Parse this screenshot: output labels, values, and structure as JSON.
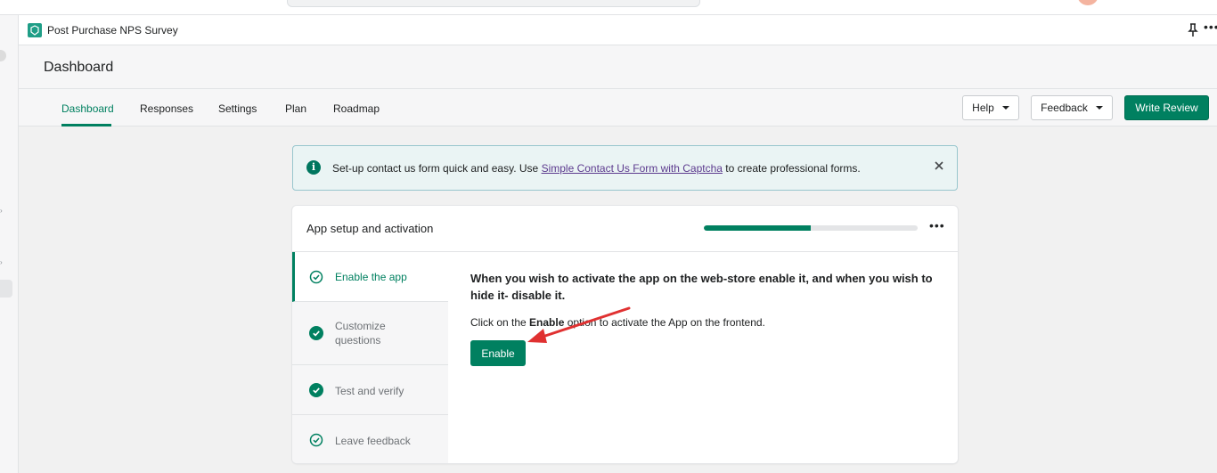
{
  "app": {
    "name": "Post Purchase NPS Survey",
    "page_title": "Dashboard"
  },
  "nav": {
    "tabs": [
      {
        "label": "Dashboard",
        "active": true
      },
      {
        "label": "Responses",
        "active": false
      },
      {
        "label": "Settings",
        "active": false
      },
      {
        "label": "Plan",
        "active": false
      },
      {
        "label": "Roadmap",
        "active": false
      }
    ],
    "help_label": "Help",
    "feedback_label": "Feedback",
    "write_review_label": "Write Review"
  },
  "banner": {
    "text_before": "Set-up contact us form quick and easy. Use ",
    "link_text": "Simple Contact Us Form with Captcha",
    "text_after": " to create professional forms."
  },
  "setup": {
    "title": "App setup and activation",
    "progress": 0.5,
    "steps": [
      {
        "label": "Enable the app",
        "active": true
      },
      {
        "label": "Customize questions",
        "active": false
      },
      {
        "label": "Test and verify",
        "active": false
      },
      {
        "label": "Leave feedback",
        "active": false
      }
    ],
    "heading": "When you wish to activate the app on the web-store enable it, and when you wish to hide it- disable it.",
    "desc_before": "Click on the ",
    "desc_bold": "Enable",
    "desc_after": " option to activate the App on the frontend.",
    "enable_label": "Enable"
  },
  "colors": {
    "accent": "#008060",
    "banner_bg": "#eaf4f4",
    "annotation_arrow": "#e03131"
  }
}
